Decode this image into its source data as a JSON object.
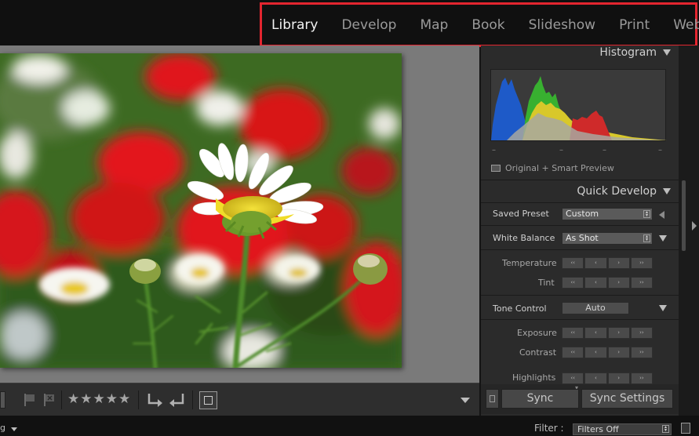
{
  "modules": [
    "Library",
    "Develop",
    "Map",
    "Book",
    "Slideshow",
    "Print",
    "Web"
  ],
  "active_module": "Library",
  "histogram": {
    "title": "Histogram",
    "ticks": [
      "–",
      "–",
      "–",
      "–"
    ],
    "preview_status": "Original + Smart Preview"
  },
  "quick_develop": {
    "title": "Quick Develop",
    "saved_preset": {
      "label": "Saved Preset",
      "value": "Custom"
    },
    "white_balance": {
      "label": "White Balance",
      "value": "As Shot"
    },
    "temperature": "Temperature",
    "tint": "Tint",
    "tone_control": {
      "label": "Tone Control",
      "button": "Auto"
    },
    "exposure": "Exposure",
    "contrast": "Contrast",
    "highlights": "Highlights"
  },
  "stepper_glyphs": [
    "‹‹",
    "‹",
    "›",
    "››"
  ],
  "sync": {
    "sync_label": "Sync",
    "sync_settings_label": "Sync Settings"
  },
  "toolbar": {
    "stars": "★★★★★"
  },
  "filterbar": {
    "left_text": "g",
    "filter_label": "Filter :",
    "filter_value": "Filters Off"
  },
  "colors": {
    "highlight_border": "#e3252f",
    "panel_bg": "#2b2b2b"
  }
}
